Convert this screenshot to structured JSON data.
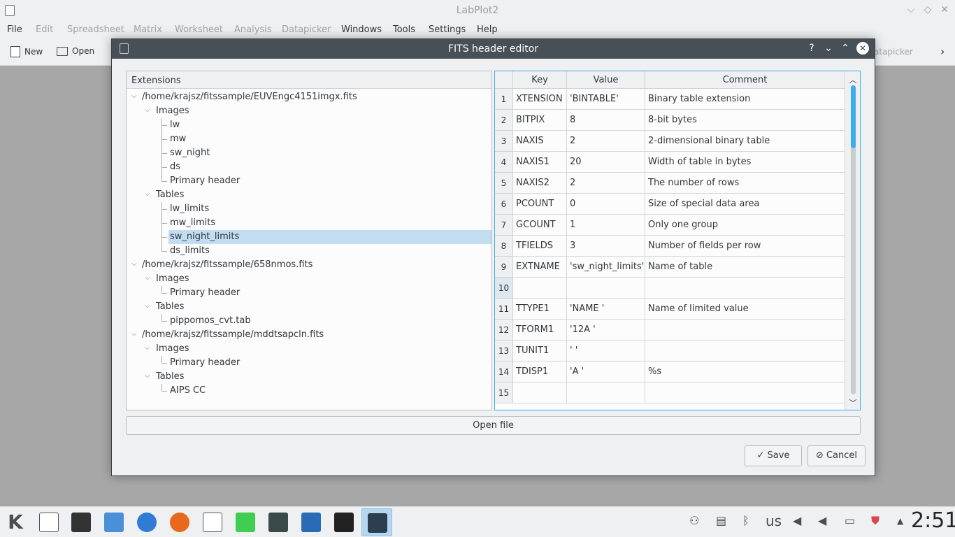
{
  "app": {
    "title": "LabPlot2",
    "window_controls": [
      "⌵",
      "◇",
      "✕"
    ]
  },
  "menu": {
    "items": [
      {
        "label": "File",
        "enabled": true
      },
      {
        "label": "Edit",
        "enabled": false
      },
      {
        "label": "Spreadsheet",
        "enabled": false
      },
      {
        "label": "Matrix",
        "enabled": false
      },
      {
        "label": "Worksheet",
        "enabled": false
      },
      {
        "label": "Analysis",
        "enabled": false
      },
      {
        "label": "Datapicker",
        "enabled": false
      },
      {
        "label": "Windows",
        "enabled": true
      },
      {
        "label": "Tools",
        "enabled": true
      },
      {
        "label": "Settings",
        "enabled": true
      },
      {
        "label": "Help",
        "enabled": true
      }
    ]
  },
  "toolbar": {
    "new_label": "New",
    "open_label": "Open",
    "hidden_right_label": "atapicker",
    "overflow_icon": "chevron-right-icon"
  },
  "dialog": {
    "title": "FITS header editor",
    "buttons": [
      "?",
      "⌄",
      "⌃",
      "✕"
    ],
    "tree_header": "Extensions",
    "tree": [
      {
        "label": "/home/krajsz/fitssample/EUVEngc4151imgx.fits",
        "level": 0,
        "expanded": true
      },
      {
        "label": "Images",
        "level": 1,
        "expanded": true
      },
      {
        "label": "lw",
        "level": 2
      },
      {
        "label": "mw",
        "level": 2
      },
      {
        "label": "sw_night",
        "level": 2
      },
      {
        "label": "ds",
        "level": 2
      },
      {
        "label": "Primary header",
        "level": 2
      },
      {
        "label": "Tables",
        "level": 1,
        "expanded": true
      },
      {
        "label": "lw_limits",
        "level": 2
      },
      {
        "label": "mw_limits",
        "level": 2
      },
      {
        "label": "sw_night_limits",
        "level": 2,
        "selected": true
      },
      {
        "label": "ds_limits",
        "level": 2
      },
      {
        "label": "/home/krajsz/fitssample/658nmos.fits",
        "level": 0,
        "expanded": true
      },
      {
        "label": "Images",
        "level": 1,
        "expanded": true
      },
      {
        "label": "Primary header",
        "level": 2
      },
      {
        "label": "Tables",
        "level": 1,
        "expanded": true
      },
      {
        "label": "pippomos_cvt.tab",
        "level": 2
      },
      {
        "label": "/home/krajsz/fitssample/mddtsapcln.fits",
        "level": 0,
        "expanded": true
      },
      {
        "label": "Images",
        "level": 1,
        "expanded": true
      },
      {
        "label": "Primary header",
        "level": 2
      },
      {
        "label": "Tables",
        "level": 1,
        "expanded": true
      },
      {
        "label": "AIPS CC",
        "level": 2
      }
    ],
    "table": {
      "columns": [
        "Key",
        "Value",
        "Comment"
      ],
      "rows": [
        {
          "n": "1",
          "key": "XTENSION",
          "value": "'BINTABLE'",
          "comment": "Binary table extension"
        },
        {
          "n": "2",
          "key": "BITPIX",
          "value": "8",
          "comment": "8-bit bytes"
        },
        {
          "n": "3",
          "key": "NAXIS",
          "value": "2",
          "comment": "2-dimensional binary table"
        },
        {
          "n": "4",
          "key": "NAXIS1",
          "value": "20",
          "comment": "Width of table in bytes"
        },
        {
          "n": "5",
          "key": "NAXIS2",
          "value": "2",
          "comment": "The number of rows"
        },
        {
          "n": "6",
          "key": "PCOUNT",
          "value": "0",
          "comment": "Size of special data area"
        },
        {
          "n": "7",
          "key": "GCOUNT",
          "value": "1",
          "comment": "Only one group"
        },
        {
          "n": "8",
          "key": "TFIELDS",
          "value": "3",
          "comment": "Number of fields per row"
        },
        {
          "n": "9",
          "key": "EXTNAME",
          "value": "'sw_night_limits'",
          "comment": "Name of table"
        },
        {
          "n": "10",
          "key": "",
          "value": "",
          "comment": ""
        },
        {
          "n": "11",
          "key": "TTYPE1",
          "value": "'NAME '",
          "comment": "Name of limited value"
        },
        {
          "n": "12",
          "key": "TFORM1",
          "value": "'12A '",
          "comment": ""
        },
        {
          "n": "13",
          "key": "TUNIT1",
          "value": "' '",
          "comment": ""
        },
        {
          "n": "14",
          "key": "TDISP1",
          "value": "'A '",
          "comment": "%s"
        },
        {
          "n": "15",
          "key": "",
          "value": "",
          "comment": ""
        }
      ]
    },
    "open_file_label": "Open file",
    "save_label": "Save",
    "cancel_label": "Cancel"
  },
  "taskbar": {
    "tray": {
      "layout": "us"
    },
    "clock": "2:51"
  }
}
